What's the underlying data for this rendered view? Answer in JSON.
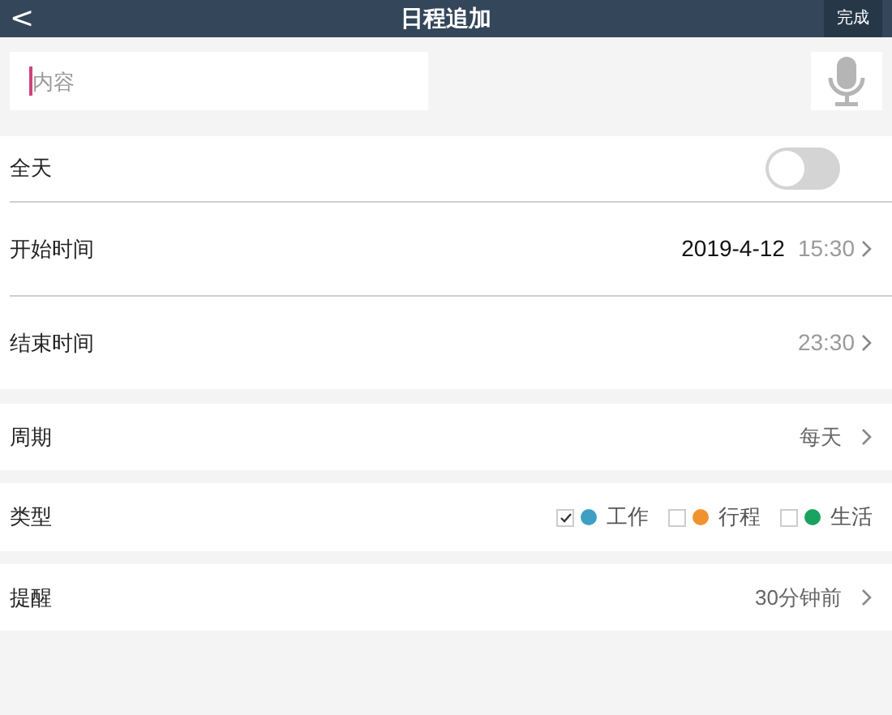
{
  "header": {
    "back": "<",
    "title": "日程追加",
    "done": "完成"
  },
  "content": {
    "placeholder": "内容"
  },
  "all_day": {
    "label": "全天",
    "on": false
  },
  "start": {
    "label": "开始时间",
    "date": "2019-4-12",
    "time": "15:30"
  },
  "end": {
    "label": "结束时间",
    "time": "23:30"
  },
  "repeat": {
    "label": "周期",
    "value": "每天"
  },
  "type": {
    "label": "类型",
    "options": [
      {
        "label": "工作",
        "checked": true,
        "color": "#3d9fc2"
      },
      {
        "label": "行程",
        "checked": false,
        "color": "#f0922e"
      },
      {
        "label": "生活",
        "checked": false,
        "color": "#1aa260"
      }
    ]
  },
  "reminder": {
    "label": "提醒",
    "value": "30分钟前"
  }
}
